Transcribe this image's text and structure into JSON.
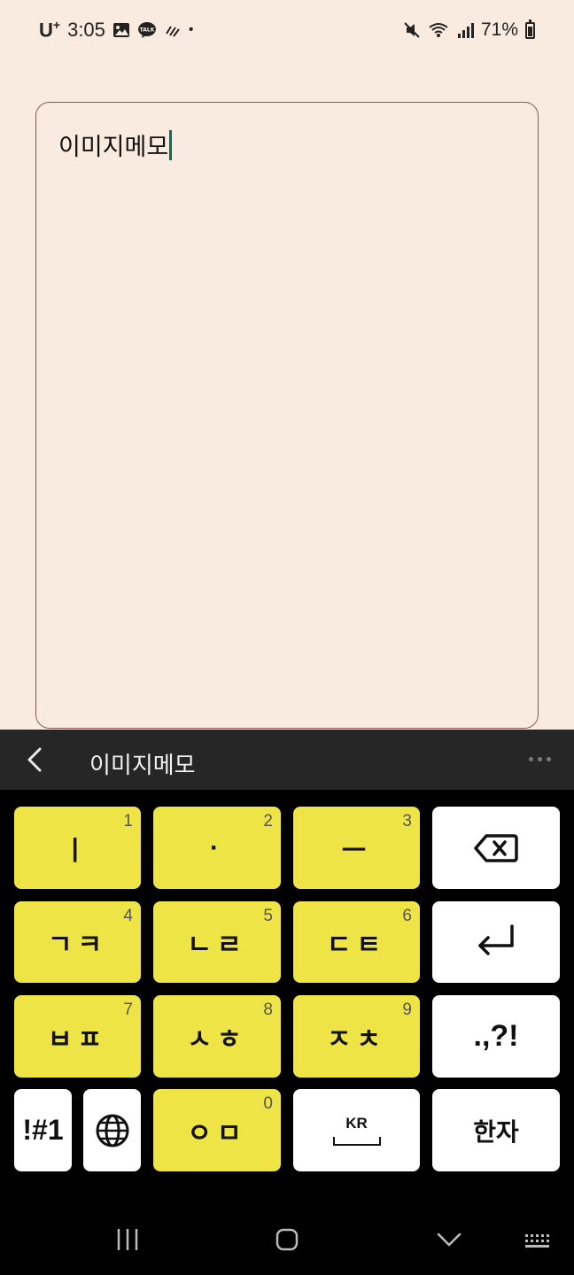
{
  "status_bar": {
    "carrier": "U",
    "carrier_sup": "+",
    "time": "3:05",
    "dot": "•",
    "battery": "71%"
  },
  "memo": {
    "text": "이미지메모"
  },
  "suggestion_bar": {
    "word": "이미지메모"
  },
  "keyboard": {
    "rows": [
      [
        {
          "label": "ㅣ",
          "num": "1"
        },
        {
          "label": "·",
          "num": "2"
        },
        {
          "label": "ㅡ",
          "num": "3"
        }
      ],
      [
        {
          "label": "ㄱㅋ",
          "num": "4"
        },
        {
          "label": "ㄴㄹ",
          "num": "5"
        },
        {
          "label": "ㄷㅌ",
          "num": "6"
        }
      ],
      [
        {
          "label": "ㅂㅍ",
          "num": "7"
        },
        {
          "label": "ㅅㅎ",
          "num": "8"
        },
        {
          "label": "ㅈㅊ",
          "num": "9"
        }
      ]
    ],
    "punct": ".,?!",
    "symbols": "!#1",
    "zero_key": {
      "label": "ㅇㅁ",
      "num": "0"
    },
    "space_lang": "KR",
    "hanja": "한자"
  },
  "colors": {
    "key_yellow": "#efe445",
    "memo_border": "#8a5a52",
    "caret": "#0a6b5d"
  }
}
